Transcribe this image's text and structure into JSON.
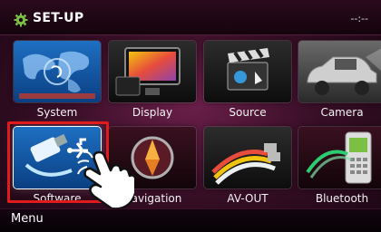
{
  "header": {
    "title": "SET-UP",
    "time": "--:--"
  },
  "tiles": [
    {
      "label": "System"
    },
    {
      "label": "Display"
    },
    {
      "label": "Source"
    },
    {
      "label": "Camera"
    },
    {
      "label": "Software"
    },
    {
      "label": "Navigation"
    },
    {
      "label": "AV-OUT"
    },
    {
      "label": "Bluetooth"
    }
  ],
  "footer": {
    "menu_label": "Menu"
  },
  "colors": {
    "background": "#3a0f28",
    "highlight": "#e01b1b"
  },
  "icons": [
    "gear-icon",
    "world-map-icon",
    "display-icon",
    "film-clapper-icon",
    "car-icon",
    "usb-icon",
    "navigation-compass-icon",
    "av-cable-icon",
    "phone-icon",
    "pointing-hand-icon"
  ]
}
